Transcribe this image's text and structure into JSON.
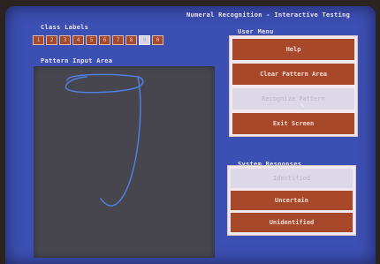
{
  "header": {
    "title": "Numeral Recognition - Interactive Testing"
  },
  "class_labels": {
    "heading": "Class Labels",
    "items": [
      "1",
      "2",
      "3",
      "4",
      "5",
      "6",
      "7",
      "8",
      "9",
      "0"
    ],
    "highlighted": "9"
  },
  "pattern": {
    "heading": "Pattern Input Area"
  },
  "user_menu": {
    "heading": "User Menu",
    "items": [
      "Help",
      "Clear Pattern Area",
      "Recognize Pattern",
      "Exit Screen"
    ],
    "selected": "Recognize Pattern"
  },
  "system_responses": {
    "heading": "System Responses",
    "items": [
      "Identified",
      "Uncertain",
      "Unidentified"
    ],
    "selected": "Identified"
  },
  "colors": {
    "screen": "#3c4fb3",
    "button": "#a8482b",
    "button_selected": "#dcd8e8",
    "stroke": "#4f7fe0"
  }
}
